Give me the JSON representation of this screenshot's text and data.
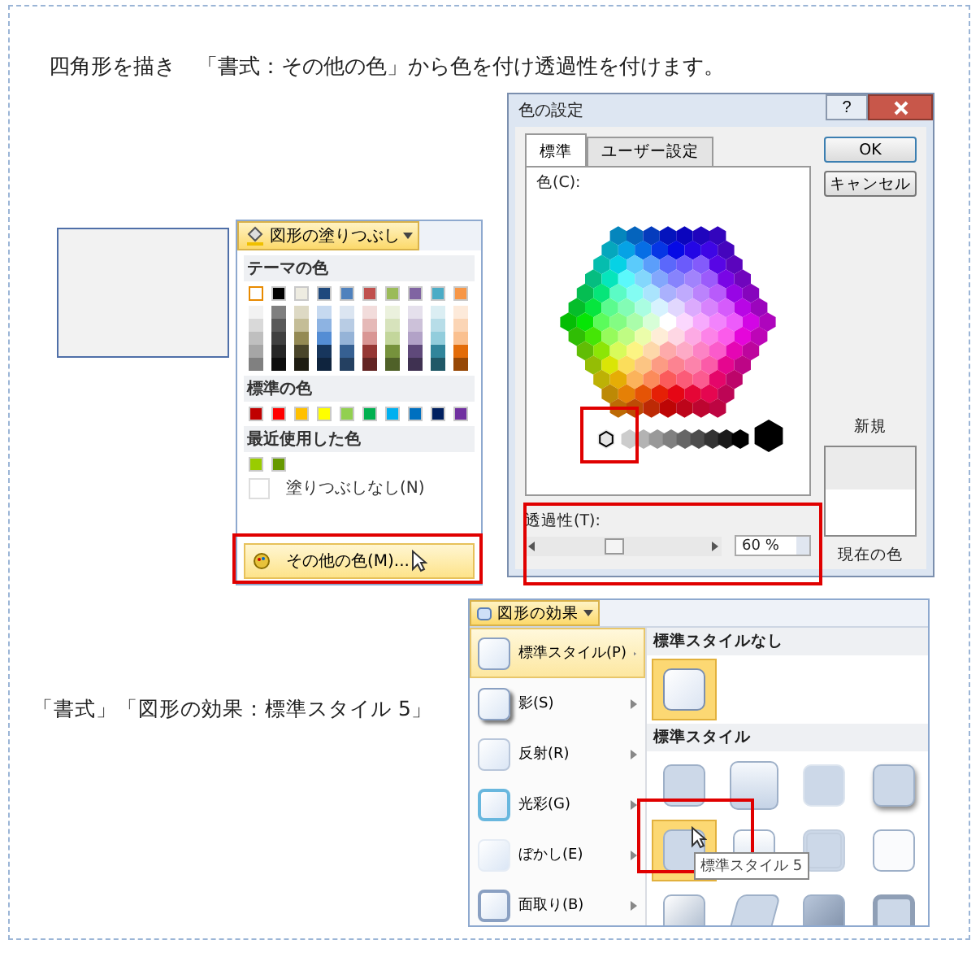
{
  "caption_top": "四角形を描き　「書式：その他の色」から色を付け透過性を付けます。",
  "caption_bottom": "「書式」「図形の効果：標準スタイル 5」",
  "fill_menu": {
    "button": "図形の塗りつぶし",
    "theme_heading": "テーマの色",
    "theme_columns": [
      {
        "color": "#ffffff",
        "selected": true,
        "shades": [
          {
            "color": "#f2f2f2"
          },
          {
            "color": "#d9d9d9"
          },
          {
            "color": "#bfbfbf"
          },
          {
            "color": "#a6a6a6"
          },
          {
            "color": "#808080"
          }
        ]
      },
      {
        "color": "#000000",
        "selected": false,
        "shades": [
          {
            "color": "#7f7f7f"
          },
          {
            "color": "#595959"
          },
          {
            "color": "#404040"
          },
          {
            "color": "#262626"
          },
          {
            "color": "#0d0d0d"
          }
        ]
      },
      {
        "color": "#eeece1",
        "selected": false,
        "shades": [
          {
            "color": "#ddd9c4"
          },
          {
            "color": "#c4bd97"
          },
          {
            "color": "#948a54"
          },
          {
            "color": "#4a452a"
          },
          {
            "color": "#1e1c11"
          }
        ]
      },
      {
        "color": "#1f497d",
        "selected": false,
        "shades": [
          {
            "color": "#c6d9f0"
          },
          {
            "color": "#8db3e2"
          },
          {
            "color": "#548dd4"
          },
          {
            "color": "#17365d"
          },
          {
            "color": "#0f243e"
          }
        ]
      },
      {
        "color": "#4f81bd",
        "selected": false,
        "shades": [
          {
            "color": "#dbe5f1"
          },
          {
            "color": "#b8cce4"
          },
          {
            "color": "#95b3d7"
          },
          {
            "color": "#366092"
          },
          {
            "color": "#244061"
          }
        ]
      },
      {
        "color": "#c0504d",
        "selected": false,
        "shades": [
          {
            "color": "#f2dcdb"
          },
          {
            "color": "#e5b9b7"
          },
          {
            "color": "#d99694"
          },
          {
            "color": "#953734"
          },
          {
            "color": "#632423"
          }
        ]
      },
      {
        "color": "#9bbb59",
        "selected": false,
        "shades": [
          {
            "color": "#ebf1dd"
          },
          {
            "color": "#d7e3bc"
          },
          {
            "color": "#c3d69b"
          },
          {
            "color": "#76923c"
          },
          {
            "color": "#4f6128"
          }
        ]
      },
      {
        "color": "#8064a2",
        "selected": false,
        "shades": [
          {
            "color": "#e5e0ec"
          },
          {
            "color": "#ccc1d9"
          },
          {
            "color": "#b2a2c7"
          },
          {
            "color": "#5f497a"
          },
          {
            "color": "#3f3151"
          }
        ]
      },
      {
        "color": "#4bacc6",
        "selected": false,
        "shades": [
          {
            "color": "#dbeef3"
          },
          {
            "color": "#b7dde8"
          },
          {
            "color": "#92cddc"
          },
          {
            "color": "#31859b"
          },
          {
            "color": "#205867"
          }
        ]
      },
      {
        "color": "#f79646",
        "selected": false,
        "shades": [
          {
            "color": "#fdeada"
          },
          {
            "color": "#fbd5b5"
          },
          {
            "color": "#fac08f"
          },
          {
            "color": "#e36c09"
          },
          {
            "color": "#974806"
          }
        ]
      }
    ],
    "standard_heading": "標準の色",
    "standard_colors": [
      {
        "color": "#c00000"
      },
      {
        "color": "#ff0000"
      },
      {
        "color": "#ffc000"
      },
      {
        "color": "#ffff00"
      },
      {
        "color": "#92d050"
      },
      {
        "color": "#00b050"
      },
      {
        "color": "#00b0f0"
      },
      {
        "color": "#0070c0"
      },
      {
        "color": "#002060"
      },
      {
        "color": "#7030a0"
      }
    ],
    "recent_heading": "最近使用した色",
    "recent_colors": [
      {
        "color": "#99cc00"
      },
      {
        "color": "#669900"
      }
    ],
    "no_fill": "塗りつぶしなし(N)",
    "more_colors": {
      "label": "その他の色(M)...",
      "selected": true
    }
  },
  "color_dialog": {
    "title": "色の設定",
    "help": "?",
    "tabs": [
      {
        "label": "標準",
        "selected": true
      },
      {
        "label": "ユーザー設定",
        "selected": false
      }
    ],
    "color_label": "色(C):",
    "ok": "OK",
    "cancel": "キャンセル",
    "new_label": "新規",
    "current_label": "現在の色",
    "transparency_label": "透過性(T):",
    "transparency": {
      "level": 0.45,
      "value": "60 %"
    }
  },
  "effects_menu": {
    "button": "図形の効果",
    "items": [
      {
        "kind": "preset",
        "label": "標準スタイル(P)",
        "selected": true
      },
      {
        "kind": "shadow",
        "label": "影(S)",
        "selected": false
      },
      {
        "kind": "reflection",
        "label": "反射(R)",
        "selected": false
      },
      {
        "kind": "glow",
        "label": "光彩(G)",
        "selected": false
      },
      {
        "kind": "soft",
        "label": "ぼかし(E)",
        "selected": false
      },
      {
        "kind": "bevel",
        "label": "面取り(B)",
        "selected": false
      }
    ],
    "none_heading": "標準スタイルなし",
    "none_preset": {
      "selected": true
    },
    "presets_heading": "標準スタイル",
    "presets": [
      {
        "selected": false
      },
      {
        "selected": false
      },
      {
        "selected": false
      },
      {
        "selected": false
      },
      {
        "selected": true
      },
      {
        "selected": false
      },
      {
        "selected": false
      },
      {
        "selected": false
      },
      {
        "selected": false
      },
      {
        "selected": false
      },
      {
        "selected": false
      },
      {
        "selected": false
      }
    ],
    "tooltip": "標準スタイル 5"
  }
}
